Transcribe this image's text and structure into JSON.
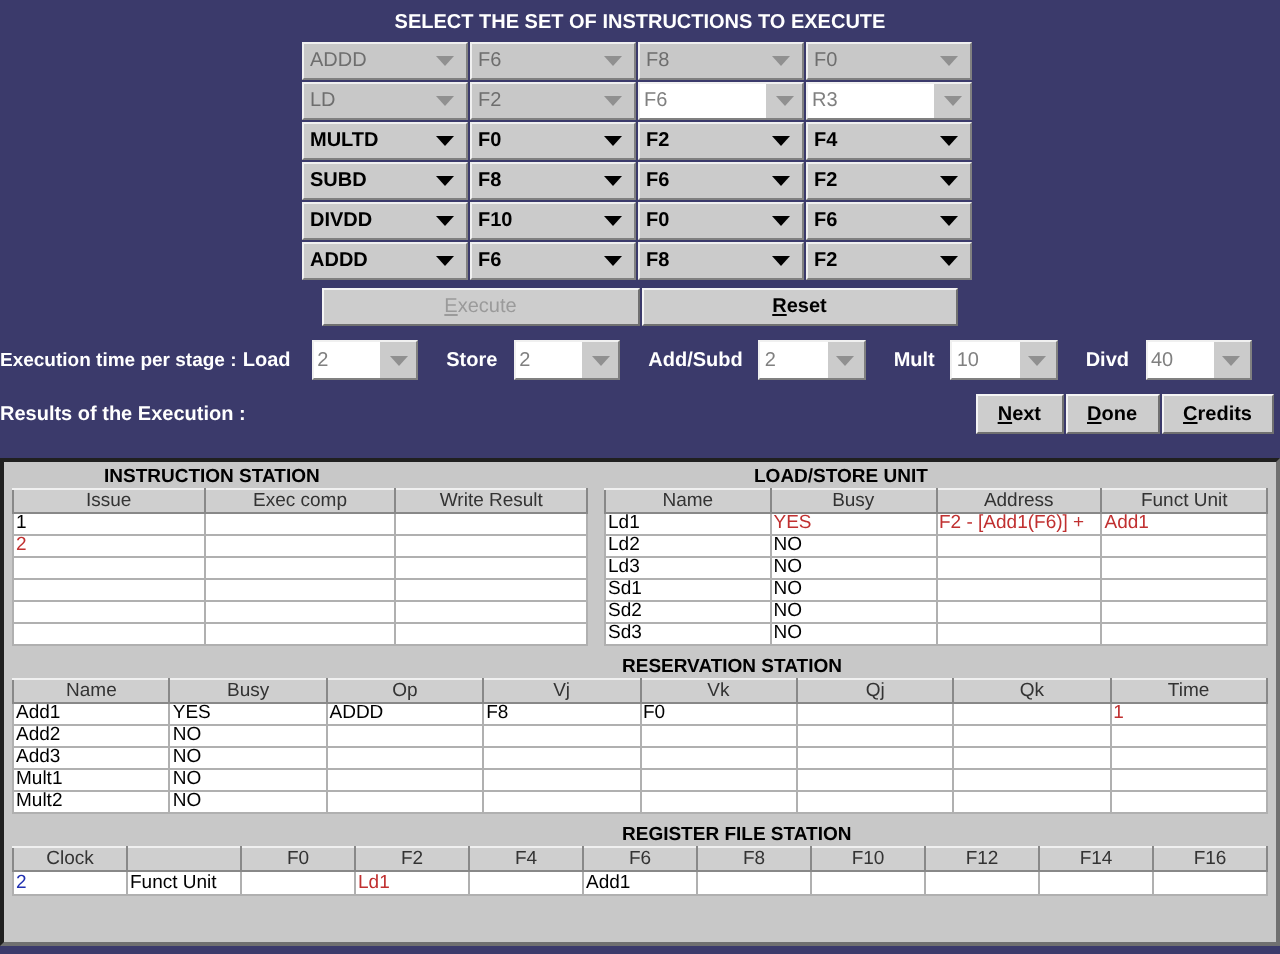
{
  "title": "SELECT THE SET OF INSTRUCTIONS TO EXECUTE",
  "instructions": [
    {
      "disabled": true,
      "fields": [
        {
          "kind": "select",
          "value": "ADDD"
        },
        {
          "kind": "select",
          "value": "F6"
        },
        {
          "kind": "select",
          "value": "F8"
        },
        {
          "kind": "select",
          "value": "F0"
        }
      ]
    },
    {
      "disabled": true,
      "fields": [
        {
          "kind": "select",
          "value": "LD"
        },
        {
          "kind": "select",
          "value": "F2"
        },
        {
          "kind": "editable",
          "value": "F6"
        },
        {
          "kind": "editable",
          "value": "R3"
        }
      ]
    },
    {
      "disabled": false,
      "fields": [
        {
          "kind": "select",
          "value": "MULTD"
        },
        {
          "kind": "select",
          "value": "F0"
        },
        {
          "kind": "select",
          "value": "F2"
        },
        {
          "kind": "select",
          "value": "F4"
        }
      ]
    },
    {
      "disabled": false,
      "fields": [
        {
          "kind": "select",
          "value": "SUBD"
        },
        {
          "kind": "select",
          "value": "F8"
        },
        {
          "kind": "select",
          "value": "F6"
        },
        {
          "kind": "select",
          "value": "F2"
        }
      ]
    },
    {
      "disabled": false,
      "fields": [
        {
          "kind": "select",
          "value": "DIVDD"
        },
        {
          "kind": "select",
          "value": "F10"
        },
        {
          "kind": "select",
          "value": "F0"
        },
        {
          "kind": "select",
          "value": "F6"
        }
      ]
    },
    {
      "disabled": false,
      "fields": [
        {
          "kind": "select",
          "value": "ADDD"
        },
        {
          "kind": "select",
          "value": "F6"
        },
        {
          "kind": "select",
          "value": "F8"
        },
        {
          "kind": "select",
          "value": "F2"
        }
      ]
    }
  ],
  "actions": [
    {
      "label": "Execute",
      "disabled": true
    },
    {
      "label": "Reset",
      "disabled": false
    }
  ],
  "execution_time": {
    "label": "Execution time per stage :",
    "stages": [
      {
        "name": "Load",
        "value": "2",
        "disabled": true
      },
      {
        "name": "Store",
        "value": "2",
        "disabled": true
      },
      {
        "name": "Add/Subd",
        "value": "2",
        "disabled": true
      },
      {
        "name": "Mult",
        "value": "10",
        "disabled": true
      },
      {
        "name": "Divd",
        "value": "40",
        "disabled": true
      }
    ]
  },
  "results_label": "Results of the Execution :",
  "result_buttons": [
    "Next",
    "Done",
    "Credits"
  ],
  "instruction_station": {
    "title": "INSTRUCTION STATION",
    "columns": [
      "Issue",
      "Exec comp",
      "Write Result"
    ],
    "rows": [
      [
        "1",
        null,
        null
      ],
      [
        {
          "text": "2",
          "color": "#c03030"
        },
        null,
        null
      ],
      [
        null,
        null,
        null
      ],
      [
        null,
        null,
        null
      ],
      [
        null,
        null,
        null
      ],
      [
        null,
        null,
        null
      ]
    ]
  },
  "load_store_unit": {
    "title": "LOAD/STORE UNIT",
    "columns": [
      "Name",
      "Busy",
      "Address",
      "Funct Unit"
    ],
    "rows": [
      [
        "Ld1",
        {
          "text": "YES",
          "color": "#c03030"
        },
        {
          "text": "F2 - [Add1(F6)] +",
          "color": "#c03030"
        },
        {
          "text": "Add1",
          "color": "#c03030"
        }
      ],
      [
        "Ld2",
        "NO",
        null,
        null
      ],
      [
        "Ld3",
        "NO",
        null,
        null
      ],
      [
        "Sd1",
        "NO",
        null,
        null
      ],
      [
        "Sd2",
        "NO",
        null,
        null
      ],
      [
        "Sd3",
        "NO",
        null,
        null
      ]
    ]
  },
  "reservation_station": {
    "title": "RESERVATION STATION",
    "columns": [
      "Name",
      "Busy",
      "Op",
      "Vj",
      "Vk",
      "Qj",
      "Qk",
      "Time"
    ],
    "rows": [
      [
        "Add1",
        "YES",
        "ADDD",
        "F8",
        "F0",
        null,
        null,
        {
          "text": "1",
          "color": "#c03030"
        }
      ],
      [
        "Add2",
        "NO",
        null,
        null,
        null,
        null,
        null,
        null
      ],
      [
        "Add3",
        "NO",
        null,
        null,
        null,
        null,
        null,
        null
      ],
      [
        "Mult1",
        "NO",
        null,
        null,
        null,
        null,
        null,
        null
      ],
      [
        "Mult2",
        "NO",
        null,
        null,
        null,
        null,
        null,
        null
      ]
    ]
  },
  "register_file_station": {
    "title": "REGISTER FILE STATION",
    "clock_header": "Clock",
    "clock": {
      "text": "2",
      "color": "#2030b0"
    },
    "row_label": "Funct Unit",
    "registers": [
      {
        "name": "F0"
      },
      {
        "name": "F2",
        "unit": {
          "text": "Ld1",
          "color": "#c03030"
        }
      },
      {
        "name": "F4"
      },
      {
        "name": "F6",
        "unit": "Add1"
      },
      {
        "name": "F8"
      },
      {
        "name": "F10"
      },
      {
        "name": "F12"
      },
      {
        "name": "F14"
      },
      {
        "name": "F16"
      }
    ]
  }
}
